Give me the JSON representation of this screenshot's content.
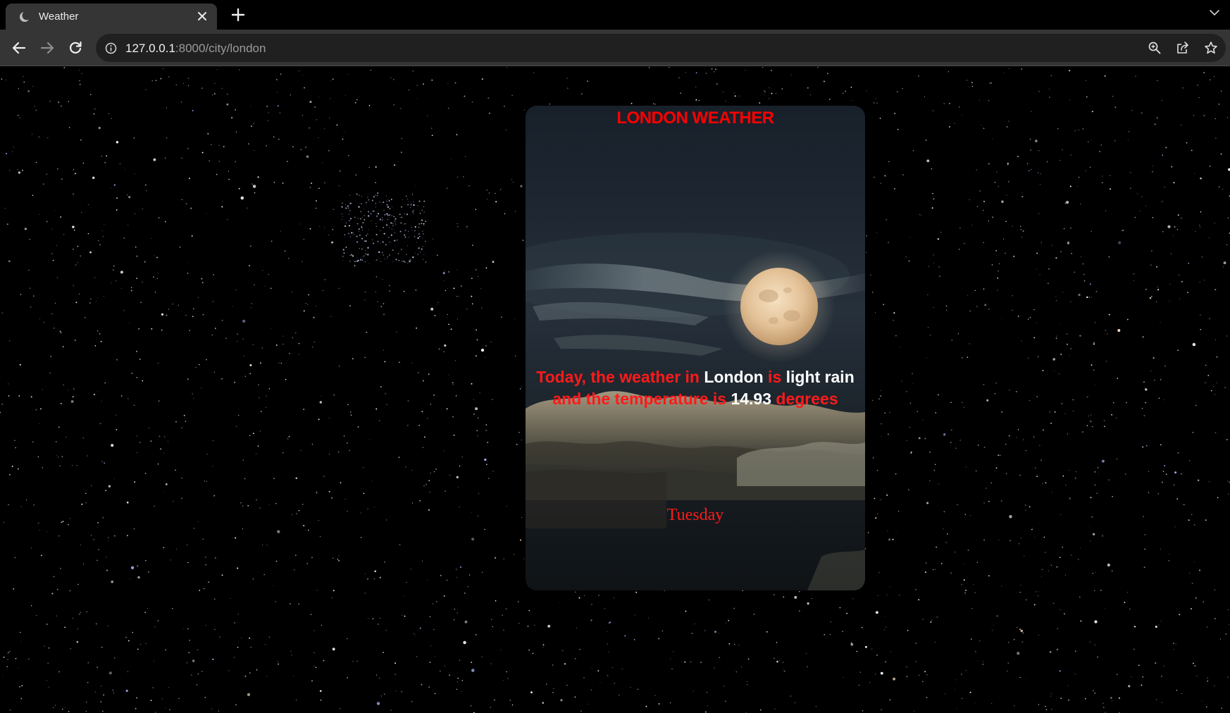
{
  "browser": {
    "tab_title": "Weather",
    "url_host": "127.0.0.1",
    "url_rest": ":8000/city/london",
    "icons": [
      "moon-favicon-icon",
      "close-icon",
      "plus-icon",
      "chevron-down-icon",
      "back-arrow-icon",
      "forward-arrow-icon",
      "reload-icon",
      "info-icon",
      "zoom-icon",
      "share-icon",
      "star-icon"
    ]
  },
  "weather": {
    "title": "LONDON WEATHER",
    "line1_prefix": "Today, the weather in ",
    "city": "London",
    "is_word": " is ",
    "condition": "light rain",
    "line2_prefix": "and the temperature is ",
    "temperature": "14.93",
    "unit_word": " degrees",
    "day": "Tuesday"
  },
  "colors": {
    "accent_red": "#ff0000",
    "highlight_white": "#ffffff",
    "chrome_dark": "#353535",
    "page_bg": "#000000"
  }
}
